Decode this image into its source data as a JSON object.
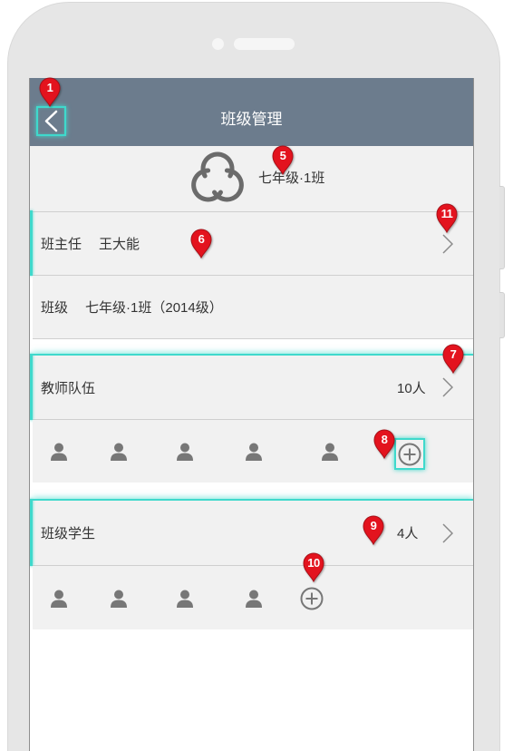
{
  "header": {
    "title": "班级管理",
    "back_icon": "chevron-left-icon"
  },
  "class_card": {
    "logo_icon": "swirl-logo-icon",
    "name": "七年级·1班"
  },
  "head_teacher": {
    "label": "班主任",
    "value": "王大能",
    "chevron_icon": "chevron-right-icon"
  },
  "class_info": {
    "label": "班级",
    "value": "七年级·1班（2014级）"
  },
  "teachers": {
    "label": "教师队伍",
    "count": "10人",
    "chevron_icon": "chevron-right-icon",
    "avatars": [
      "user-icon",
      "user-icon",
      "user-icon",
      "user-icon",
      "user-icon"
    ],
    "add_icon": "plus-circle-icon"
  },
  "students": {
    "label": "班级学生",
    "count": "4人",
    "chevron_icon": "chevron-right-icon",
    "avatars": [
      "user-icon",
      "user-icon",
      "user-icon",
      "user-icon"
    ],
    "add_icon": "plus-circle-icon"
  },
  "annotations": [
    "1",
    "5",
    "6",
    "11",
    "7",
    "8",
    "9",
    "10"
  ],
  "colors": {
    "frame": "#e6e6e6",
    "header": "#6c7c8d",
    "row": "#f1f1f1",
    "divider": "#cfcfcf",
    "text": "#333333",
    "icon": "#777777",
    "highlight": "#3fd9cc",
    "pin": "#e3131e"
  }
}
